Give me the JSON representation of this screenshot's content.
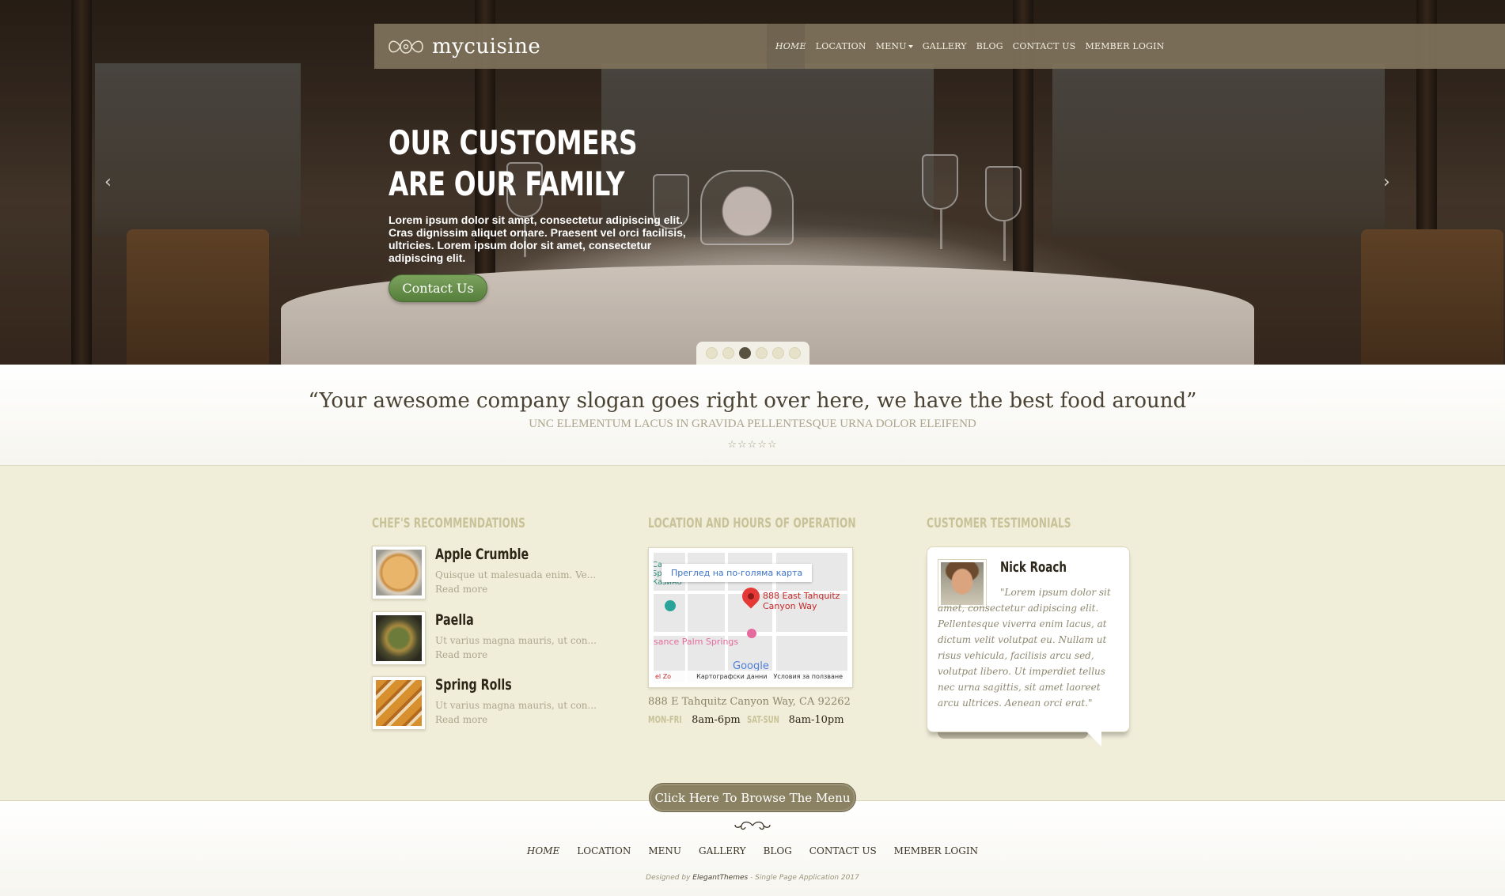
{
  "brand": {
    "name": "mycuisine"
  },
  "nav": {
    "items": [
      {
        "label": "Home"
      },
      {
        "label": "Location"
      },
      {
        "label": "Menu"
      },
      {
        "label": "Gallery"
      },
      {
        "label": "Blog"
      },
      {
        "label": "Contact Us"
      },
      {
        "label": "Member Login"
      }
    ]
  },
  "hero": {
    "title": "OUR CUSTOMERS ARE OUR FAMILY",
    "text": "Lorem ipsum dolor sit amet, consectetur adipiscing elit. Cras dignissim aliquet ornare. Praesent vel orci facilisis, ultricies. Lorem ipsum dolor sit amet, consectetur adipiscing elit.",
    "button": "Contact Us",
    "prev_arrow": "‹",
    "next_arrow": "›",
    "slides_total": 6,
    "active_slide": 3
  },
  "slogan": {
    "quote": "“Your awesome company slogan goes right over here, we have the best food around”",
    "sub": "UNC ELEMENTUM LACUS IN GRAVIDA PELLENTESQUE URNA DOLOR ELEIFEND",
    "stars": "☆☆☆☆☆"
  },
  "recommendations": {
    "title": "Chef's Recommendations",
    "items": [
      {
        "name": "Apple Crumble",
        "desc": "Quisque ut malesuada enim. Ve...",
        "more": "Read more"
      },
      {
        "name": "Paella",
        "desc": "Ut varius magna mauris, ut con...",
        "more": "Read more"
      },
      {
        "name": "Spring Rolls",
        "desc": "Ut varius magna mauris, ut con...",
        "more": "Read more"
      }
    ]
  },
  "location": {
    "title": "Location and Hours of Operation",
    "map_link": "Преглед на по-голяма карта",
    "map_pin_label_1": "888 East Tahquitz",
    "map_pin_label_2": "Canyon Way",
    "map_top_left": "Ca",
    "map_springs": "Springs",
    "map_casino_label": "Казино",
    "map_casino": "sance Palm Springs",
    "map_google": "Google",
    "map_data": "Картографски данни",
    "map_terms": "Условия за ползване",
    "map_corner": "el Zo",
    "address": "888 E Tahquitz Canyon Way, CA 92262",
    "weekday_label": "MON-FRI",
    "weekday_hours": "8am-6pm",
    "weekend_label": "SAT-SUN",
    "weekend_hours": "8am-10pm"
  },
  "testimonials": {
    "title": "Customer Testimonials",
    "name": "Nick Roach",
    "text": "\"Lorem ipsum dolor sit amet, consectetur adipiscing elit. Pellentesque viverra enim lacus, at dictum velit volutpat eu. Nullam ut risus vehicula, facilisis arcu sed, volutpat libero. Ut imperdiet tellus nec urna sagittis, sit amet laoreet arcu ultrices. Aenean orci erat.\""
  },
  "browse_button": "Click Here To Browse The Menu",
  "footer": {
    "nav": [
      {
        "label": "Home"
      },
      {
        "label": "Location"
      },
      {
        "label": "Menu"
      },
      {
        "label": "Gallery"
      },
      {
        "label": "Blog"
      },
      {
        "label": "Contact Us"
      },
      {
        "label": "Member Login"
      }
    ],
    "credit_prefix": "Designed by",
    "credit_brand": "ElegantThemes",
    "credit_suffix": "- Single Page Application 2017"
  },
  "colors": {
    "accent_green": "#6b9450",
    "bar_brown": "#80735c",
    "cream": "#f0eed9",
    "muted_gold": "#c9c299"
  }
}
